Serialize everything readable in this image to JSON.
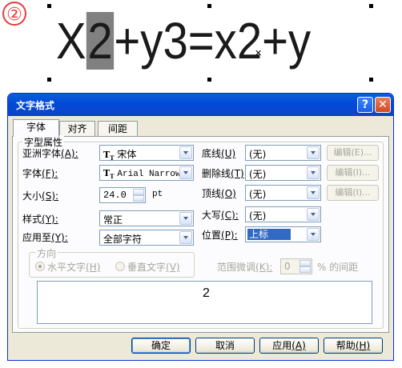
{
  "step_marker": "②",
  "formula": {
    "before": "X",
    "selected": "2",
    "after": "+y3=x2+y"
  },
  "dialog": {
    "title": "文字格式",
    "help_glyph": "?",
    "close_glyph": "✕",
    "tabs": [
      {
        "label": "字体",
        "active": true
      },
      {
        "label": "对齐",
        "active": false
      },
      {
        "label": "间距",
        "active": false
      }
    ],
    "font_group_label": "字型属性",
    "fields": {
      "asian_font": {
        "label": "亚洲字体",
        "key": "(A):",
        "value": "宋体"
      },
      "font": {
        "label": "字体",
        "key": "(F):",
        "value": "Arial Narrow"
      },
      "size": {
        "label": "大小",
        "key": "(S):",
        "value": "24.0",
        "unit": "pt"
      },
      "style": {
        "label": "样式",
        "key": "(Y):",
        "value": "常正"
      },
      "apply_to": {
        "label": "应用至",
        "key": "(Y):",
        "value": "全部字符"
      },
      "underline": {
        "label": "底线",
        "key": "(U)",
        "value": "(无)"
      },
      "strikethrough": {
        "label": "删除线",
        "key": "(T)",
        "value": "(无)"
      },
      "overline": {
        "label": "顶线",
        "key": "(O)",
        "value": "(无)"
      },
      "caps": {
        "label": "大写",
        "key": "(C):",
        "value": "(无)"
      },
      "position": {
        "label": "位置",
        "key": "(P):",
        "value": "上标"
      }
    },
    "edit_buttons": [
      {
        "label": "编辑",
        "key": "(E)..."
      },
      {
        "label": "编辑",
        "key": "(I)..."
      },
      {
        "label": "编辑",
        "key": "(I)..."
      }
    ],
    "direction": {
      "group_label": "方向",
      "horizontal": "水平文字",
      "horizontal_key": "(H)",
      "vertical": "垂直文字",
      "vertical_key": "(V)"
    },
    "range": {
      "label": "范围微调",
      "key": "(K):",
      "value": "0",
      "suffix": "% 的间距"
    },
    "preview_text": "2",
    "buttons": {
      "ok": "确定",
      "cancel": "取消",
      "apply": "应用",
      "apply_key": "(A)",
      "help": "帮助",
      "help_key": "(H)"
    }
  }
}
